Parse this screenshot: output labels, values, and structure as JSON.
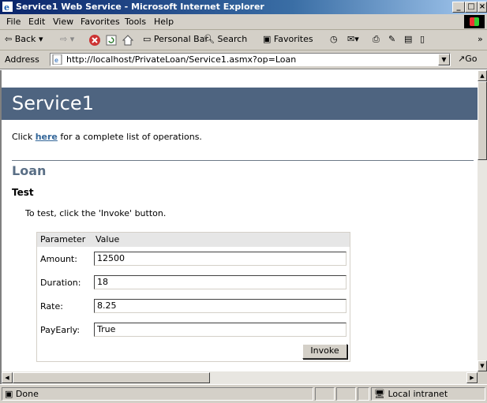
{
  "window": {
    "title": "Service1 Web Service - Microsoft Internet Explorer",
    "min": "_",
    "max": "□",
    "close": "×"
  },
  "menu": {
    "file": "File",
    "edit": "Edit",
    "view": "View",
    "favorites": "Favorites",
    "tools": "Tools",
    "help": "Help"
  },
  "toolbar": {
    "back": "Back",
    "personal_bar": "Personal Bar",
    "search": "Search",
    "favorites": "Favorites",
    "more": "»"
  },
  "address": {
    "label": "Address",
    "url": "http://localhost/PrivateLoan/Service1.asmx?op=Loan",
    "go": "Go"
  },
  "page": {
    "heading": "Service1",
    "click_prefix": "Click ",
    "click_link": "here",
    "click_suffix": " for a complete list of operations.",
    "operation": "Loan",
    "test_heading": "Test",
    "test_info": "To test, click the 'Invoke' button.",
    "table": {
      "col_param": "Parameter",
      "col_value": "Value",
      "rows": [
        {
          "label": "Amount:",
          "value": "12500"
        },
        {
          "label": "Duration:",
          "value": "18"
        },
        {
          "label": "Rate:",
          "value": "8.25"
        },
        {
          "label": "PayEarly:",
          "value": "True"
        }
      ],
      "invoke": "Invoke"
    }
  },
  "status": {
    "text": "Done",
    "zone": "Local intranet"
  }
}
